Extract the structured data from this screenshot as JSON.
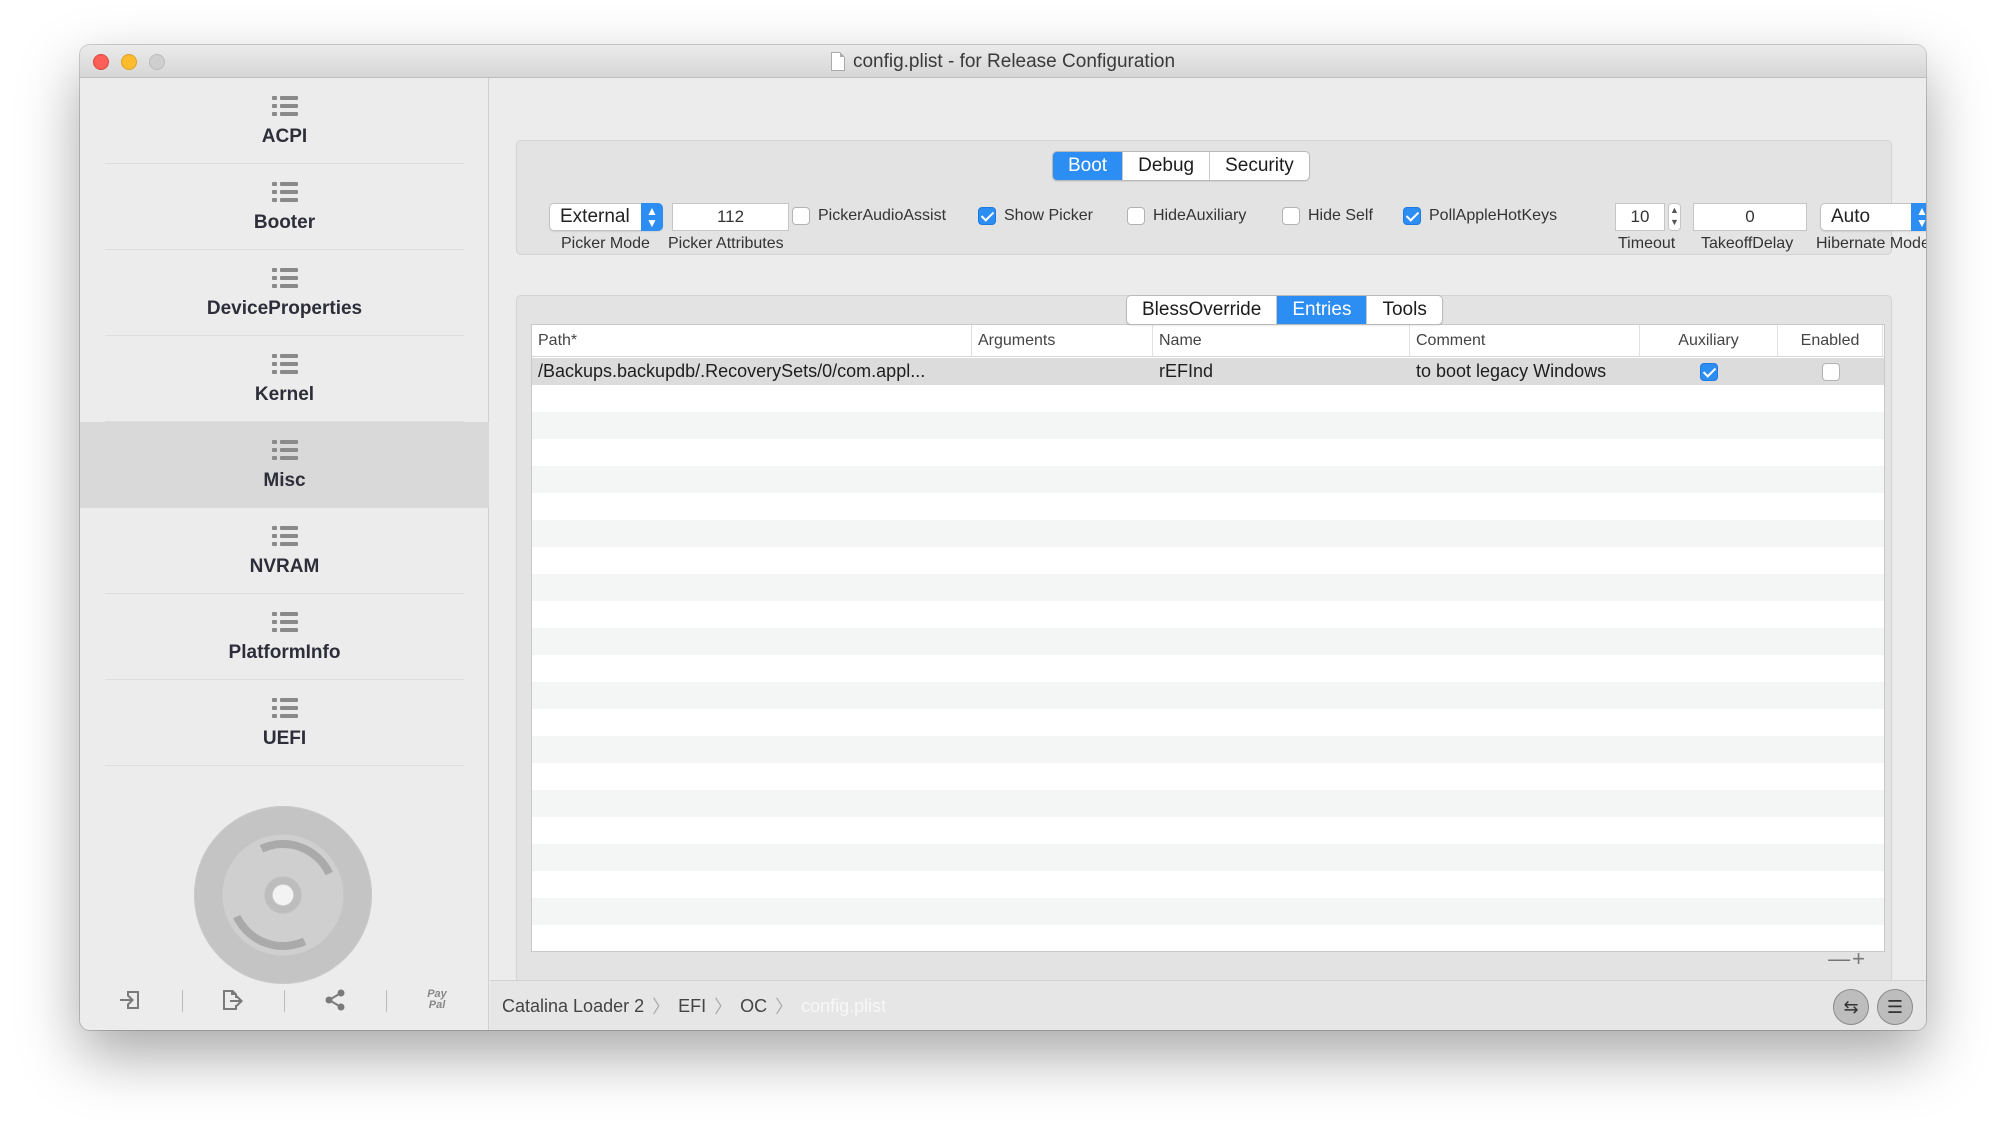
{
  "window": {
    "title": "config.plist - for Release Configuration"
  },
  "sidebar": {
    "items": [
      {
        "label": "ACPI"
      },
      {
        "label": "Booter"
      },
      {
        "label": "DeviceProperties"
      },
      {
        "label": "Kernel"
      },
      {
        "label": "Misc",
        "selected": true
      },
      {
        "label": "NVRAM"
      },
      {
        "label": "PlatformInfo"
      },
      {
        "label": "UEFI"
      }
    ],
    "bottom_buttons": [
      "import-icon",
      "export-icon",
      "share-icon",
      "paypal-icon"
    ],
    "paypal_text": "Pay\nPal"
  },
  "top_tabs": {
    "items": [
      "Boot",
      "Debug",
      "Security"
    ],
    "active": "Boot"
  },
  "boot": {
    "picker_mode": {
      "value": "External",
      "caption": "Picker Mode"
    },
    "picker_attributes": {
      "value": "112",
      "caption": "Picker Attributes"
    },
    "checkboxes": [
      {
        "label": "PickerAudioAssist",
        "checked": false
      },
      {
        "label": "Show Picker",
        "checked": true
      },
      {
        "label": "HideAuxiliary",
        "checked": false
      },
      {
        "label": "Hide Self",
        "checked": false
      },
      {
        "label": "PollAppleHotKeys",
        "checked": true
      }
    ],
    "timeout": {
      "value": "10",
      "caption": "Timeout"
    },
    "takeoff_delay": {
      "value": "0",
      "caption": "TakeoffDelay"
    },
    "hibernate_mode": {
      "value": "Auto",
      "caption": "Hibernate Mode"
    }
  },
  "sub_tabs": {
    "items": [
      "BlessOverride",
      "Entries",
      "Tools"
    ],
    "active": "Entries"
  },
  "table": {
    "columns": [
      "Path*",
      "Arguments",
      "Name",
      "Comment",
      "Auxiliary",
      "Enabled"
    ],
    "rows": [
      {
        "path": "/Backups.backupdb/.RecoverySets/0/com.appl...",
        "arguments": "",
        "name": "rEFInd",
        "comment": "to boot legacy Windows",
        "auxiliary": true,
        "enabled": false
      }
    ],
    "add_remove": "—+"
  },
  "pathbar": {
    "crumbs": [
      "Catalina Loader 2",
      "EFI",
      "OC",
      "config.plist"
    ]
  },
  "colors": {
    "accent": "#2c8df3",
    "sidebar_selected": "#d9d9d9"
  }
}
